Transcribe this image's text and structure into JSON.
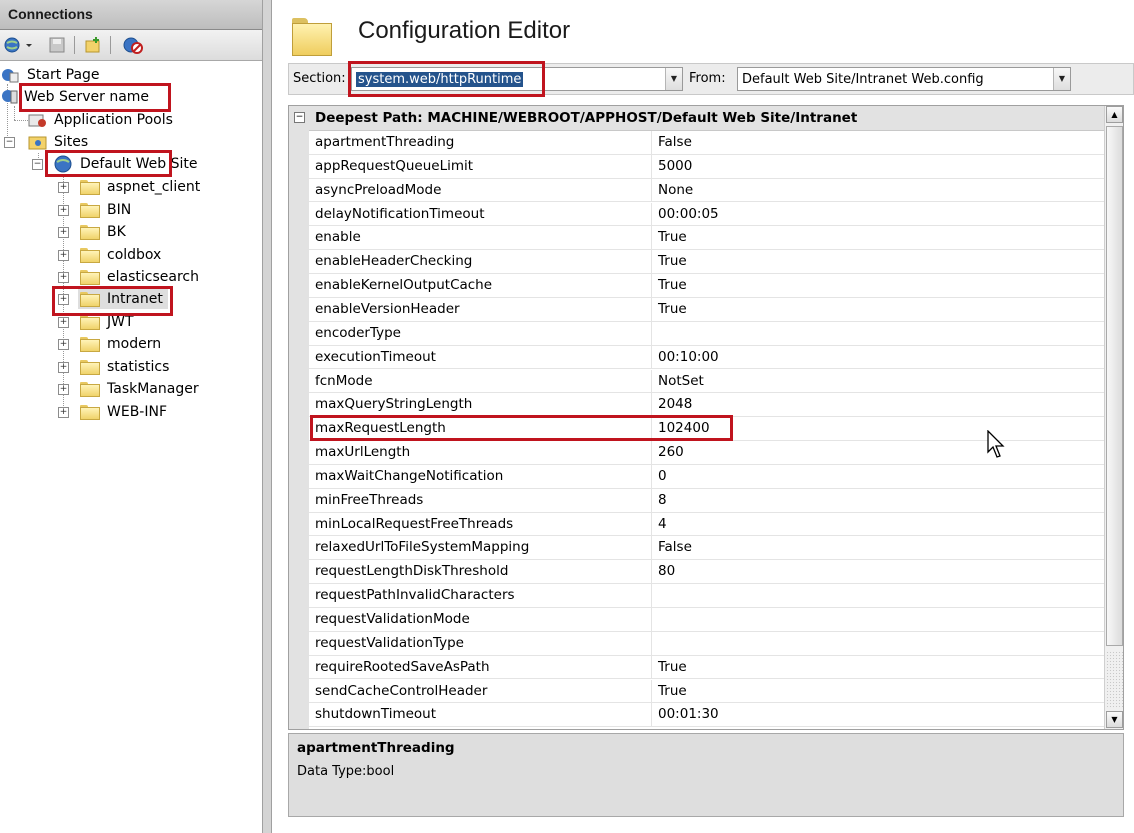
{
  "connections": {
    "title": "Connections",
    "tree": [
      {
        "label": "Start Page"
      },
      {
        "label": "Web Server name"
      },
      {
        "label": "Application Pools"
      },
      {
        "label": "Sites"
      },
      {
        "label": "Default Web Site"
      },
      {
        "label": "aspnet_client"
      },
      {
        "label": "BIN"
      },
      {
        "label": "BK"
      },
      {
        "label": "coldbox"
      },
      {
        "label": "elasticsearch"
      },
      {
        "label": "Intranet"
      },
      {
        "label": "JWT"
      },
      {
        "label": "modern"
      },
      {
        "label": "statistics"
      },
      {
        "label": "TaskManager"
      },
      {
        "label": "WEB-INF"
      }
    ]
  },
  "editor": {
    "title": "Configuration Editor",
    "section_label": "Section:",
    "section_value": "system.web/httpRuntime",
    "from_label": "From:",
    "from_value": "Default Web Site/Intranet Web.config",
    "deepest_path": "Deepest Path: MACHINE/WEBROOT/APPHOST/Default Web Site/Intranet",
    "properties": [
      {
        "name": "apartmentThreading",
        "value": "False"
      },
      {
        "name": "appRequestQueueLimit",
        "value": "5000"
      },
      {
        "name": "asyncPreloadMode",
        "value": "None"
      },
      {
        "name": "delayNotificationTimeout",
        "value": "00:00:05"
      },
      {
        "name": "enable",
        "value": "True"
      },
      {
        "name": "enableHeaderChecking",
        "value": "True"
      },
      {
        "name": "enableKernelOutputCache",
        "value": "True"
      },
      {
        "name": "enableVersionHeader",
        "value": "True"
      },
      {
        "name": "encoderType",
        "value": ""
      },
      {
        "name": "executionTimeout",
        "value": "00:10:00"
      },
      {
        "name": "fcnMode",
        "value": "NotSet"
      },
      {
        "name": "maxQueryStringLength",
        "value": "2048"
      },
      {
        "name": "maxRequestLength",
        "value": "102400"
      },
      {
        "name": "maxUrlLength",
        "value": "260"
      },
      {
        "name": "maxWaitChangeNotification",
        "value": "0"
      },
      {
        "name": "minFreeThreads",
        "value": "8"
      },
      {
        "name": "minLocalRequestFreeThreads",
        "value": "4"
      },
      {
        "name": "relaxedUrlToFileSystemMapping",
        "value": "False"
      },
      {
        "name": "requestLengthDiskThreshold",
        "value": "80"
      },
      {
        "name": "requestPathInvalidCharacters",
        "value": ""
      },
      {
        "name": "requestValidationMode",
        "value": ""
      },
      {
        "name": "requestValidationType",
        "value": ""
      },
      {
        "name": "requireRootedSaveAsPath",
        "value": "True"
      },
      {
        "name": "sendCacheControlHeader",
        "value": "True"
      },
      {
        "name": "shutdownTimeout",
        "value": "00:01:30"
      }
    ],
    "description": {
      "name": "apartmentThreading",
      "data_type": "Data Type:bool"
    }
  },
  "colors": {
    "highlight_box": "#c0141e",
    "selection": "#24538c"
  }
}
